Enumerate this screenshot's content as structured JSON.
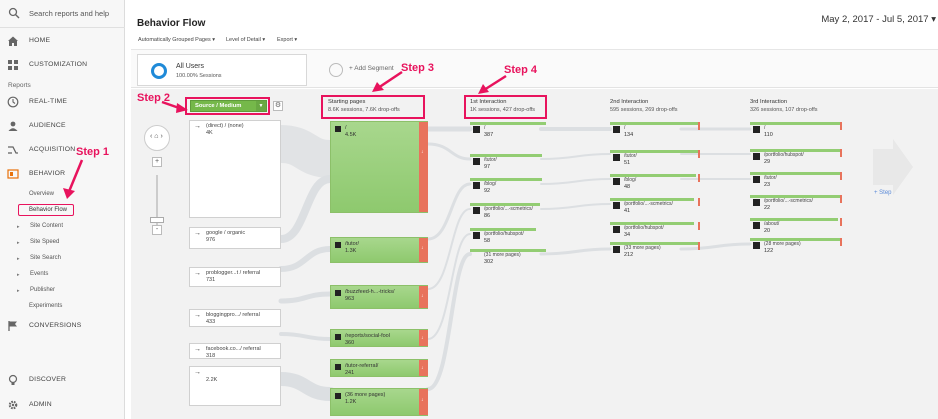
{
  "sidebar": {
    "search_placeholder": "Search reports and help",
    "nav": [
      {
        "label": "HOME",
        "icon": "home-icon"
      },
      {
        "label": "CUSTOMIZATION",
        "icon": "dashboard-icon"
      },
      {
        "label": "REAL-TIME",
        "icon": "clock-icon"
      },
      {
        "label": "AUDIENCE",
        "icon": "person-icon"
      },
      {
        "label": "ACQUISITION",
        "icon": "acquisition-icon"
      },
      {
        "label": "BEHAVIOR",
        "icon": "behavior-icon"
      },
      {
        "label": "CONVERSIONS",
        "icon": "flag-icon"
      },
      {
        "label": "DISCOVER",
        "icon": "lightbulb-icon"
      },
      {
        "label": "ADMIN",
        "icon": "gear-icon"
      }
    ],
    "reports_label": "Reports",
    "behavior_sub": [
      {
        "label": "Overview"
      },
      {
        "label": "Behavior Flow"
      },
      {
        "label": "Site Content"
      },
      {
        "label": "Site Speed"
      },
      {
        "label": "Site Search"
      },
      {
        "label": "Events"
      },
      {
        "label": "Publisher"
      },
      {
        "label": "Experiments"
      }
    ]
  },
  "header": {
    "title": "Behavior Flow",
    "date_range": "May 2, 2017 - Jul 5, 2017",
    "toolbar": [
      "Automatically Grouped Pages",
      "Level of Detail",
      "Export"
    ]
  },
  "segments": {
    "active_name": "All Users",
    "active_sub": "100.00% Sessions",
    "add_label": "+ Add Segment"
  },
  "flow": {
    "dimension_dropdown": "Source / Medium",
    "columns": [
      {
        "title": "Starting pages",
        "stats": "8.6K sessions, 7.6K drop-offs"
      },
      {
        "title": "1st Interaction",
        "stats": "1K sessions, 427 drop-offs"
      },
      {
        "title": "2nd Interaction",
        "stats": "595 sessions, 269 drop-offs"
      },
      {
        "title": "3rd Interaction",
        "stats": "326 sessions, 107 drop-offs"
      }
    ],
    "sources": [
      {
        "name": "(direct) / (none)",
        "value": "4K"
      },
      {
        "name": "google / organic",
        "value": "976"
      },
      {
        "name": "problogger...t / referral",
        "value": "731"
      },
      {
        "name": "bloggingpro.../ referral",
        "value": "433"
      },
      {
        "name": "facebook.co.../ referral",
        "value": "318"
      },
      {
        "name": "",
        "value": "2.2K"
      }
    ],
    "starting_pages": [
      {
        "name": "/",
        "value": "4.5K"
      },
      {
        "name": "/tutor/",
        "value": "1.3K"
      },
      {
        "name": "/buzzfeed-h...-tricks/",
        "value": "963"
      },
      {
        "name": "/reports/social-fool",
        "value": "360"
      },
      {
        "name": "/tutor-referral/",
        "value": "241"
      },
      {
        "name": "(36 more pages)",
        "value": "1.2K"
      }
    ],
    "first_interaction": [
      {
        "name": "/",
        "value": "387"
      },
      {
        "name": "/tutor/",
        "value": "97"
      },
      {
        "name": "/blog/",
        "value": "92"
      },
      {
        "name": "/portfolio/...-scmetrics/",
        "value": "86"
      },
      {
        "name": "/portfolio/hubspot/",
        "value": "58"
      },
      {
        "name": "(31 more pages)",
        "value": "302"
      }
    ],
    "second_interaction": [
      {
        "name": "/",
        "value": "134"
      },
      {
        "name": "/tutor/",
        "value": "51"
      },
      {
        "name": "/blog/",
        "value": "48"
      },
      {
        "name": "/portfolio/...-scmetrics/",
        "value": "41"
      },
      {
        "name": "/portfolio/hubspot/",
        "value": "34"
      },
      {
        "name": "(33 more pages)",
        "value": "212"
      }
    ],
    "third_interaction": [
      {
        "name": "/",
        "value": "110"
      },
      {
        "name": "/portfolio/hubspot/",
        "value": "29"
      },
      {
        "name": "/tutor/",
        "value": "23"
      },
      {
        "name": "/portfolio/...-scmetrics/",
        "value": "22"
      },
      {
        "name": "/about/",
        "value": "20"
      },
      {
        "name": "(28 more pages)",
        "value": "122"
      }
    ],
    "next_step_label": "+ Step"
  },
  "annotations": [
    "Step 1",
    "Step 2",
    "Step 3",
    "Step 4"
  ],
  "colors": {
    "accent": "#e8135d",
    "node_green": "#8ec96e",
    "dropoff_red": "#e8735c",
    "segment_blue": "#1f8ad8"
  }
}
